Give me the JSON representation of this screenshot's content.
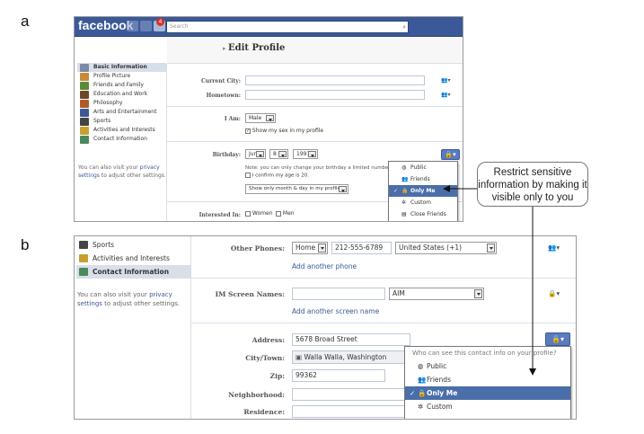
{
  "labels": {
    "a": "a",
    "b": "b"
  },
  "callout": {
    "text": "Restrict sensitive information by making it visible only to you"
  },
  "a": {
    "app_name": "facebook",
    "notification_count": "4",
    "search_placeholder": "Search",
    "page_title": "Edit Profile",
    "sidebar": [
      {
        "label": "Basic Information",
        "icon": "id-card-icon",
        "color": "#7a8ba8",
        "selected": true
      },
      {
        "label": "Profile Picture",
        "icon": "picture-icon",
        "color": "#c98a3a"
      },
      {
        "label": "Friends and Family",
        "icon": "people-icon",
        "color": "#5a8a3a"
      },
      {
        "label": "Education and Work",
        "icon": "briefcase-icon",
        "color": "#6b4a2a"
      },
      {
        "label": "Philosophy",
        "icon": "book-icon",
        "color": "#b05a2a"
      },
      {
        "label": "Arts and Entertainment",
        "icon": "music-icon",
        "color": "#3b5998"
      },
      {
        "label": "Sports",
        "icon": "ball-icon",
        "color": "#444"
      },
      {
        "label": "Activities and Interests",
        "icon": "pencil-icon",
        "color": "#c9a030"
      },
      {
        "label": "Contact Information",
        "icon": "contact-card-icon",
        "color": "#4a8a5a"
      }
    ],
    "privacy_note_pre": "You can also visit your ",
    "privacy_link": "privacy settings",
    "privacy_note_post": " to adjust other settings.",
    "form": {
      "current_city_label": "Current City:",
      "hometown_label": "Hometown:",
      "i_am_label": "I Am:",
      "i_am_value": "Male",
      "show_sex_label": "Show my sex in my profile",
      "birthday_label": "Birthday:",
      "bday_month": "Jun",
      "bday_day": "8",
      "bday_year": "1991",
      "bday_note": "Note: you can only change your birthday a limited number of",
      "confirm_age": "I confirm my age is 20.",
      "bday_show": "Show only month & day in my profile.",
      "interested_label": "Interested In:",
      "women": "Women",
      "men": "Men"
    },
    "menu": [
      {
        "label": "Public",
        "icon": "globe-icon",
        "glyph": "◍"
      },
      {
        "label": "Friends",
        "icon": "friends-icon",
        "glyph": "👥"
      },
      {
        "label": "Only Me",
        "icon": "lock-icon",
        "glyph": "🔒",
        "selected": true
      },
      {
        "label": "Custom",
        "icon": "gear-icon",
        "glyph": "✲"
      },
      {
        "label": "Close Friends",
        "icon": "list-icon",
        "glyph": "▤"
      }
    ]
  },
  "b": {
    "sidebar": [
      {
        "label": "Sports",
        "icon": "ball-icon",
        "color": "#444"
      },
      {
        "label": "Activities and Interests",
        "icon": "pencil-icon",
        "color": "#c9a030"
      },
      {
        "label": "Contact Information",
        "icon": "contact-card-icon",
        "color": "#4a8a5a",
        "selected": true
      }
    ],
    "privacy_note_pre": "You can also visit your ",
    "privacy_link": "privacy settings",
    "privacy_note_post": " to adjust other settings.",
    "form": {
      "other_phones_label": "Other Phones:",
      "phone_type": "Home",
      "phone_number": "212-555-6789",
      "phone_country": "United States (+1)",
      "add_phone": "Add another phone",
      "im_label": "IM Screen Names:",
      "im_service": "AIM",
      "add_screen_name": "Add another screen name",
      "address_label": "Address:",
      "address_value": "5678 Broad Street",
      "city_label": "City/Town:",
      "city_value": "Walla Walla, Washington",
      "zip_label": "Zip:",
      "zip_value": "99362",
      "neighborhood_label": "Neighborhood:",
      "residence_label": "Residence:"
    },
    "menu_header": "Who can see this contact info on your profile?",
    "menu": [
      {
        "label": "Public",
        "icon": "globe-icon",
        "glyph": "◍"
      },
      {
        "label": "Friends",
        "icon": "friends-icon",
        "glyph": "👥"
      },
      {
        "label": "Only Me",
        "icon": "lock-icon",
        "glyph": "🔒",
        "selected": true
      },
      {
        "label": "Custom",
        "icon": "gear-icon",
        "glyph": "✲"
      }
    ]
  }
}
